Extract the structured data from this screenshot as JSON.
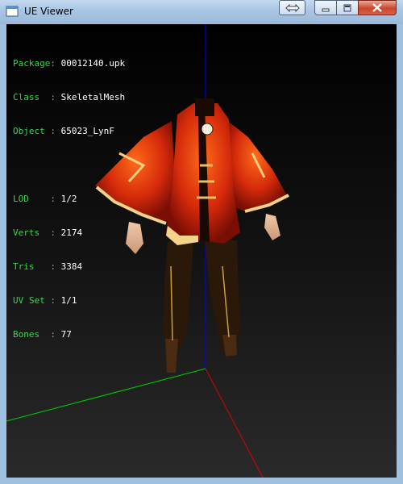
{
  "window": {
    "title": "UE Viewer"
  },
  "info_block": {
    "rows": [
      {
        "key": "Package:",
        "value": "00012140.upk"
      },
      {
        "key": "Class  :",
        "value": "SkeletalMesh"
      },
      {
        "key": "Object :",
        "value": "65023_LynF"
      },
      {
        "key": "LOD    :",
        "value": "1/2"
      },
      {
        "key": "Verts  :",
        "value": "2174"
      },
      {
        "key": "Tris   :",
        "value": "3384"
      },
      {
        "key": "UV Set :",
        "value": "1/1"
      },
      {
        "key": "Bones  :",
        "value": "77"
      }
    ]
  },
  "colors": {
    "label": "#39d54a",
    "value": "#ffffff",
    "axis_x": "#e00000",
    "axis_y": "#00d000",
    "axis_z": "#0000ff"
  }
}
